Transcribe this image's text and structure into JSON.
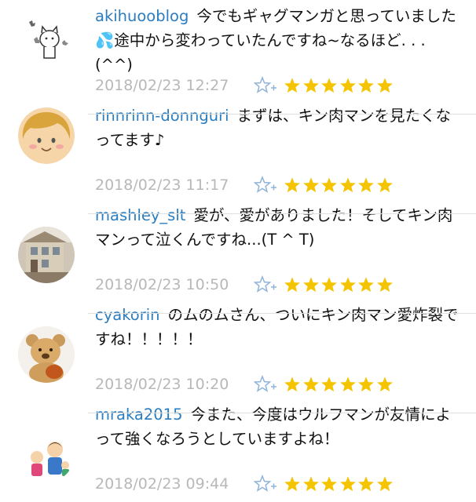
{
  "comments": [
    {
      "user": "akihuooblog",
      "text": "今でもギャグマンガと思っていました💦途中から変わっていたんですね~なるほど. . . (^^)",
      "time": "2018/02/23 12:27",
      "avatar": "cat-cartoon-icon",
      "stars": 6
    },
    {
      "user": "rinnrinn-donnguri",
      "text": "まずは、キン肉マンを見たくなってます♪",
      "time": "2018/02/23 11:17",
      "avatar": "smiley-face-icon",
      "stars": 6
    },
    {
      "user": "mashley_slt",
      "text": "愛が、愛がありました！そしてキン肉マンって泣くんですね...(T ^ T)",
      "time": "2018/02/23 10:50",
      "avatar": "house-photo-icon",
      "stars": 6
    },
    {
      "user": "cyakorin",
      "text": "のムのムさん、ついにキン肉マン愛炸裂ですね！！！！！",
      "time": "2018/02/23 10:20",
      "avatar": "teddy-bear-icon",
      "stars": 6
    },
    {
      "user": "mraka2015",
      "text": "今また、今度はウルフマンが友情によって強くなろうとしていますよね！",
      "time": "2018/02/23 09:44",
      "avatar": "family-cartoon-icon",
      "stars": 6
    }
  ],
  "colors": {
    "username": "#2a7dc0",
    "timestamp": "#b8b8b8",
    "star": "#f5c400",
    "star_add": "#8fb3d9"
  }
}
